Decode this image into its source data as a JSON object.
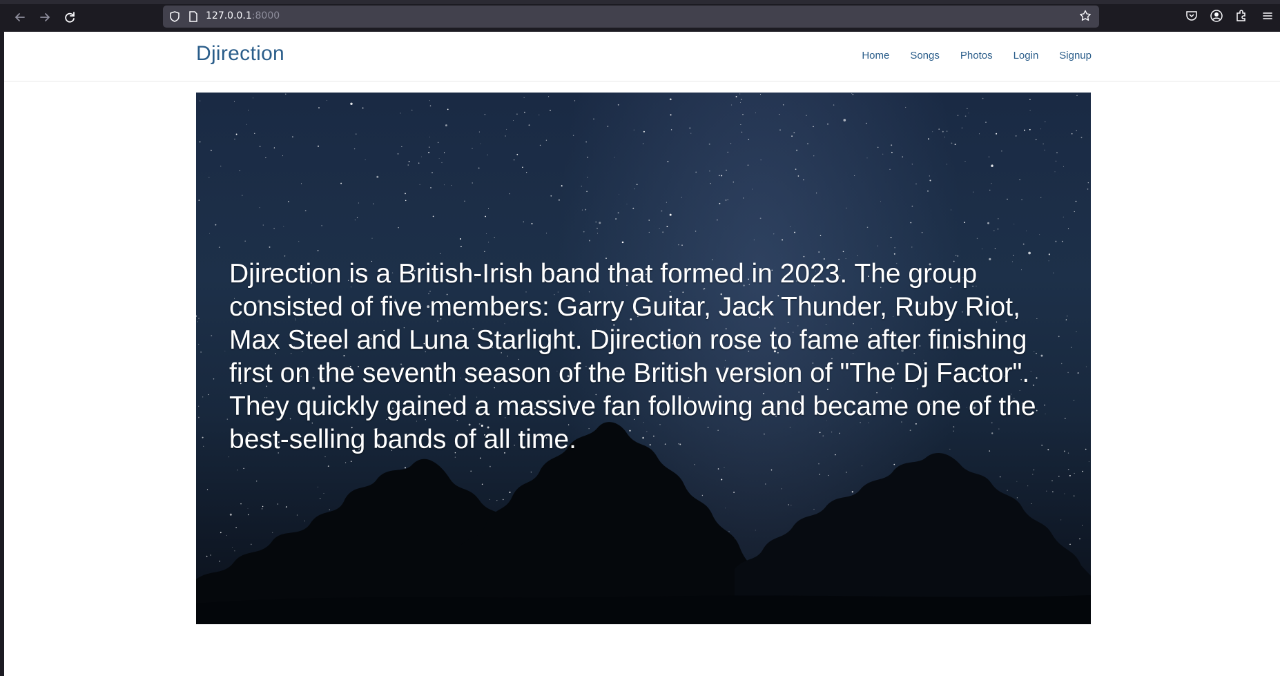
{
  "browser": {
    "url_host": "127.0.0.1",
    "url_port": ":8000",
    "icons": [
      "back-icon",
      "forward-icon",
      "reload-icon",
      "shield-icon",
      "page-icon",
      "bookmark-star-icon",
      "pocket-icon",
      "account-icon",
      "extensions-icon",
      "menu-icon"
    ]
  },
  "site": {
    "brand": "Djirection",
    "nav": [
      "Home",
      "Songs",
      "Photos",
      "Login",
      "Signup"
    ],
    "brand_color": "#2a5d8a"
  },
  "hero": {
    "text": "Djirection is a British-Irish band that formed in 2023. The group consisted of five members: Garry Guitar, Jack Thunder, Ruby Riot, Max Steel and Luna Starlight. Djirection rose to fame after finishing first on the seventh season of the British version of \"The Dj Factor\". They quickly gained a massive fan following and became one of the best-selling bands of all time.",
    "background": "starry night sky over tree silhouettes"
  }
}
